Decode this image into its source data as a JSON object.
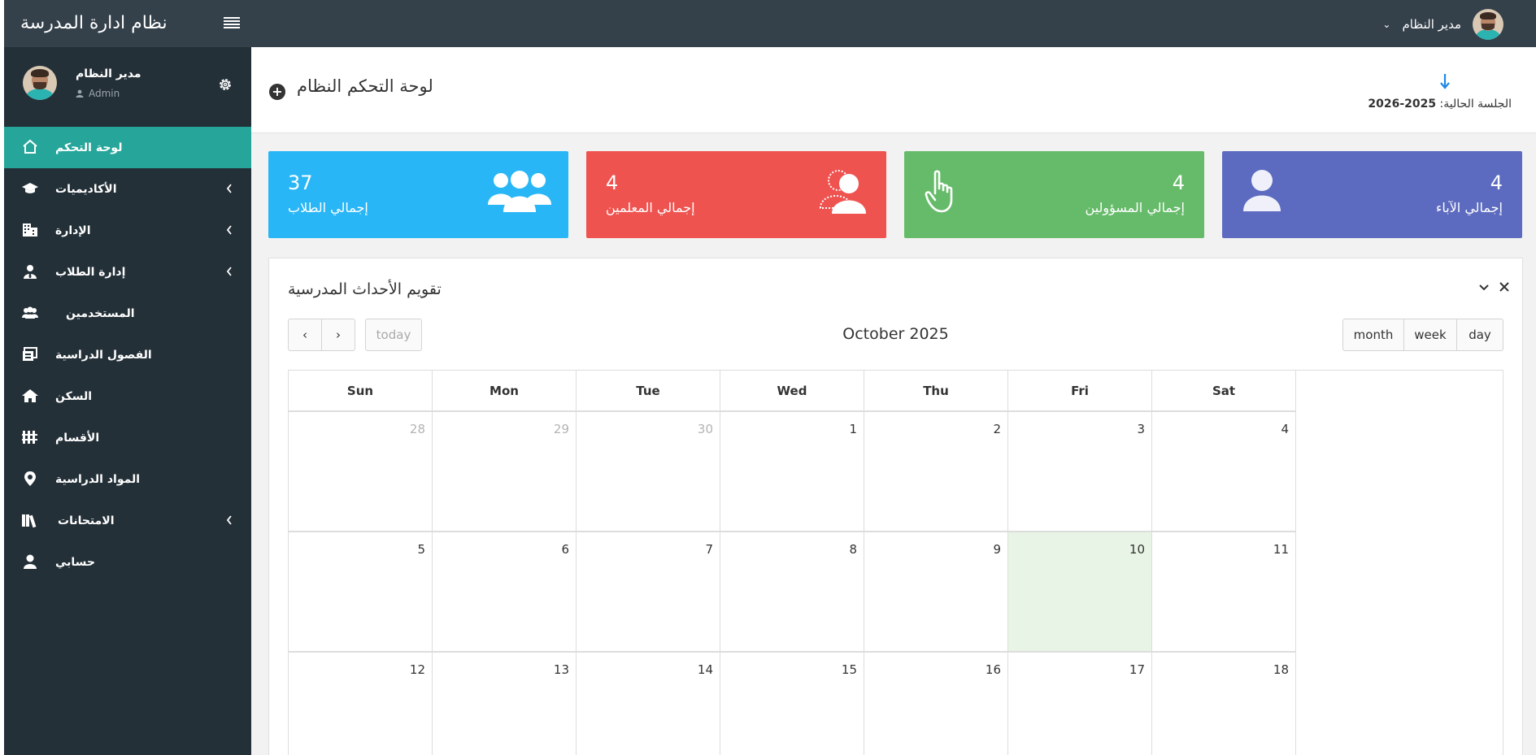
{
  "app": {
    "title": "نظام ادارة المدرسة"
  },
  "topbar": {
    "user_name": "مدير النظام",
    "caret": "⌄"
  },
  "profile": {
    "name": "مدير النظام",
    "role": "Admin"
  },
  "sidebar": {
    "active_color": "#26a69a",
    "items": [
      {
        "label": "لوحة التحكم",
        "icon": "home-icon",
        "has_children": false,
        "active": true
      },
      {
        "label": "الأكاديميات",
        "icon": "graduation-cap-icon",
        "has_children": true,
        "active": false
      },
      {
        "label": "الإدارة",
        "icon": "building-icon",
        "has_children": true,
        "active": false
      },
      {
        "label": "إدارة الطلاب",
        "icon": "user-tie-icon",
        "has_children": true,
        "active": false
      },
      {
        "label": "المستخدمين",
        "icon": "users-icon",
        "has_children": false,
        "active": false
      },
      {
        "label": "الفصول الدراسية",
        "icon": "classroom-icon",
        "has_children": false,
        "active": false
      },
      {
        "label": "السكن",
        "icon": "house-icon",
        "has_children": false,
        "active": false
      },
      {
        "label": "الأقسام",
        "icon": "columns-icon",
        "has_children": false,
        "active": false
      },
      {
        "label": "المواد الدراسية",
        "icon": "map-marker-icon",
        "has_children": false,
        "active": false
      },
      {
        "label": "الامتحانات",
        "icon": "books-icon",
        "has_children": true,
        "active": false
      },
      {
        "label": "حسابي",
        "icon": "user-icon",
        "has_children": false,
        "active": false
      }
    ]
  },
  "header": {
    "page_title": "لوحة التحكم النظام",
    "session_label": "الجلسة الحالية:",
    "session_value": "2025-2026"
  },
  "stats": [
    {
      "value": "4",
      "label": "إجمالي الآباء",
      "color": "#5c6bc0",
      "icon": "parent-user-icon"
    },
    {
      "value": "4",
      "label": "إجمالي المسؤولين",
      "color": "#66bb6a",
      "icon": "pointer-hand-icon"
    },
    {
      "value": "4",
      "label": "إجمالي المعلمين",
      "color": "#ef5350",
      "icon": "teacher-icon"
    },
    {
      "value": "37",
      "label": "إجمالي الطلاب",
      "color": "#29b6f6",
      "icon": "students-group-icon"
    }
  ],
  "calendar": {
    "panel_title": "تقويم الأحداث المدرسية",
    "month_title": "October 2025",
    "today_label": "today",
    "prev_label": "‹",
    "next_label": "›",
    "views": [
      "month",
      "week",
      "day"
    ],
    "weekdays": [
      "Sun",
      "Mon",
      "Tue",
      "Wed",
      "Thu",
      "Fri",
      "Sat"
    ],
    "weeks": [
      [
        {
          "d": "28",
          "other": true
        },
        {
          "d": "29",
          "other": true
        },
        {
          "d": "30",
          "other": true
        },
        {
          "d": "1"
        },
        {
          "d": "2"
        },
        {
          "d": "3"
        },
        {
          "d": "4"
        }
      ],
      [
        {
          "d": "5"
        },
        {
          "d": "6"
        },
        {
          "d": "7"
        },
        {
          "d": "8"
        },
        {
          "d": "9"
        },
        {
          "d": "10",
          "today": true
        },
        {
          "d": "11"
        }
      ],
      [
        {
          "d": "12"
        },
        {
          "d": "13"
        },
        {
          "d": "14"
        },
        {
          "d": "15"
        },
        {
          "d": "16"
        },
        {
          "d": "17"
        },
        {
          "d": "18"
        }
      ]
    ]
  }
}
